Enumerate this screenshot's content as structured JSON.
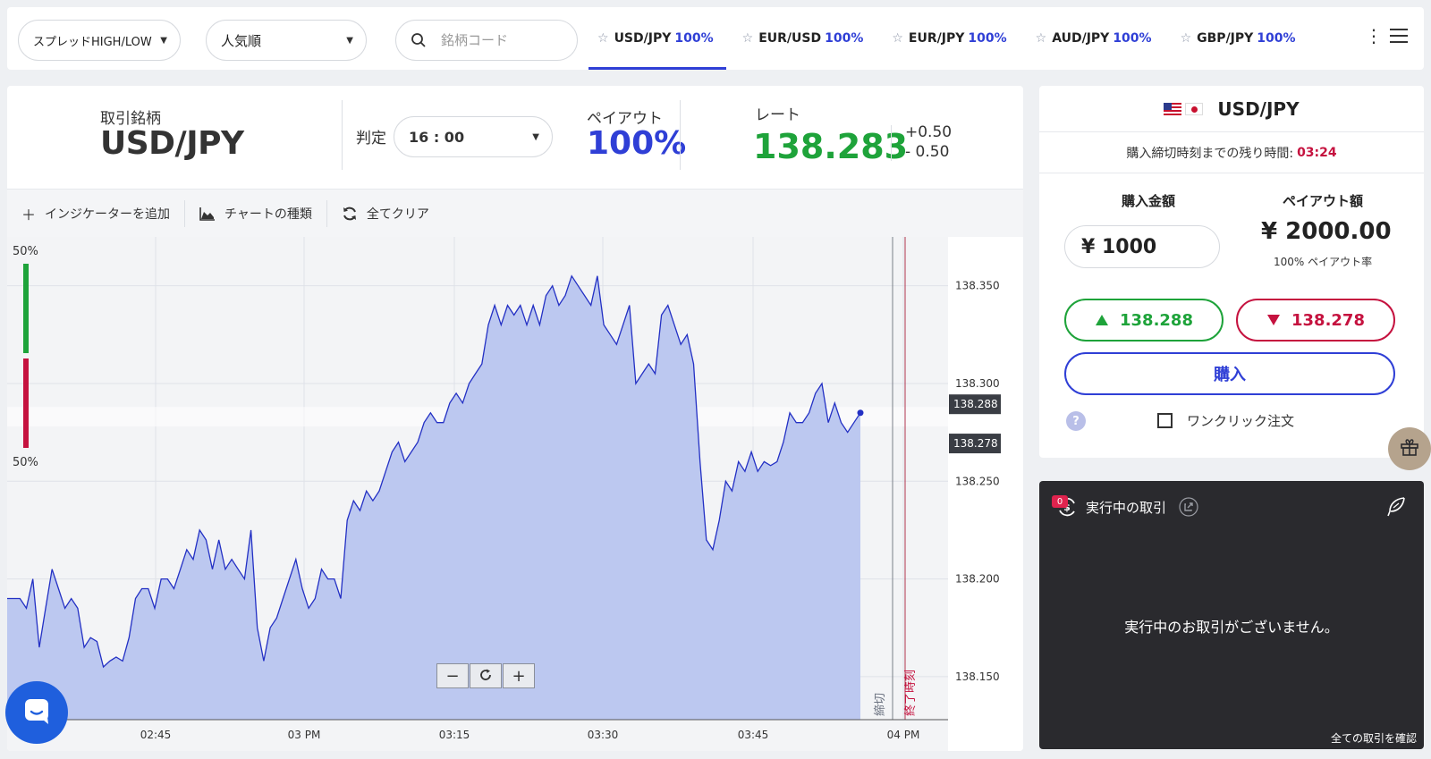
{
  "topbar": {
    "spread_filter": "スプレッドHIGH/LOW",
    "sort_order": "人気順",
    "search_placeholder": "銘柄コード",
    "pairs": [
      {
        "name": "USD/JPY",
        "pct": "100%",
        "active": true
      },
      {
        "name": "EUR/USD",
        "pct": "100%",
        "active": false
      },
      {
        "name": "EUR/JPY",
        "pct": "100%",
        "active": false
      },
      {
        "name": "AUD/JPY",
        "pct": "100%",
        "active": false
      },
      {
        "name": "GBP/JPY",
        "pct": "100%",
        "active": false
      }
    ]
  },
  "info": {
    "symbol_label": "取引銘柄",
    "symbol": "USD/JPY",
    "judge_label": "判定",
    "judge_time": "16 : 00",
    "payout_label": "ペイアウト",
    "payout": "100%",
    "rate_label": "レート",
    "rate": "138.283",
    "rate_plus": "+0.50",
    "rate_minus": "- 0.50"
  },
  "toolbar": {
    "add_indicator": "インジケーターを追加",
    "chart_type": "チャートの種類",
    "clear_all": "全てクリア"
  },
  "chart_data": {
    "type": "area",
    "sentiment_up": "50%",
    "sentiment_down": "50%",
    "y_ticks": [
      "138.350",
      "138.300",
      "138.250",
      "138.200",
      "138.150"
    ],
    "x_ticks": [
      "02:45",
      "03 PM",
      "03:15",
      "03:30",
      "03:45",
      "04 PM"
    ],
    "ask_tag": "138.288",
    "bid_tag": "138.278",
    "deadline_label": "締切",
    "end_label": "終了時刻",
    "ylim": [
      138.128,
      138.375
    ],
    "y_tick_values": [
      138.35,
      138.3,
      138.25,
      138.2,
      138.15
    ],
    "ask": 138.288,
    "bid": 138.278,
    "series": [
      {
        "values": [
          138.19,
          138.19,
          138.19,
          138.185,
          138.2,
          138.165,
          138.185,
          138.205,
          138.195,
          138.185,
          138.19,
          138.185,
          138.165,
          138.17,
          138.168,
          138.155,
          138.158,
          138.16,
          138.158,
          138.17,
          138.19,
          138.195,
          138.195,
          138.185,
          138.2,
          138.2,
          138.195,
          138.205,
          138.215,
          138.21,
          138.225,
          138.22,
          138.205,
          138.22,
          138.205,
          138.21,
          138.205,
          138.2,
          138.225,
          138.175,
          138.158,
          138.175,
          138.18,
          138.19,
          138.2,
          138.21,
          138.195,
          138.185,
          138.19,
          138.205,
          138.2,
          138.2,
          138.19,
          138.23,
          138.24,
          138.235,
          138.245,
          138.24,
          138.245,
          138.255,
          138.265,
          138.27,
          138.26,
          138.265,
          138.27,
          138.28,
          138.285,
          138.28,
          138.28,
          138.29,
          138.295,
          138.29,
          138.3,
          138.305,
          138.31,
          138.33,
          138.34,
          138.33,
          138.34,
          138.335,
          138.34,
          138.33,
          138.34,
          138.33,
          138.345,
          138.35,
          138.34,
          138.345,
          138.355,
          138.35,
          138.345,
          138.34,
          138.355,
          138.33,
          138.325,
          138.32,
          138.33,
          138.34,
          138.3,
          138.305,
          138.31,
          138.305,
          138.335,
          138.34,
          138.33,
          138.32,
          138.325,
          138.31,
          138.26,
          138.22,
          138.215,
          138.23,
          138.25,
          138.245,
          138.26,
          138.255,
          138.265,
          138.255,
          138.26,
          138.258,
          138.26,
          138.27,
          138.285,
          138.28,
          138.28,
          138.285,
          138.295,
          138.3,
          138.28,
          138.29,
          138.28,
          138.275,
          138.28,
          138.285
        ]
      }
    ]
  },
  "zoom": {
    "minus": "−",
    "plus": "+"
  },
  "order": {
    "pair": "USD/JPY",
    "deadline_label": "購入締切時刻までの残り時間:",
    "deadline_time": "03:24",
    "amount_label": "購入金額",
    "payout_amount_label": "ペイアウト額",
    "amount": "¥ 1000",
    "payout_amount": "¥ 2000.00",
    "payout_rate": "100% ペイアウト率",
    "high_price": "138.288",
    "low_price": "138.278",
    "buy_label": "購入",
    "help": "?",
    "one_click": "ワンクリック注文"
  },
  "trades": {
    "count": "0",
    "title": "実行中の取引",
    "empty_message": "実行中のお取引がございません。",
    "view_all": "全ての取引を確認"
  },
  "colors": {
    "accent": "#2f3fd6",
    "up": "#1ea33a",
    "down": "#c5123f",
    "area_fill": "#bcc8f0",
    "line": "#2330c4"
  }
}
